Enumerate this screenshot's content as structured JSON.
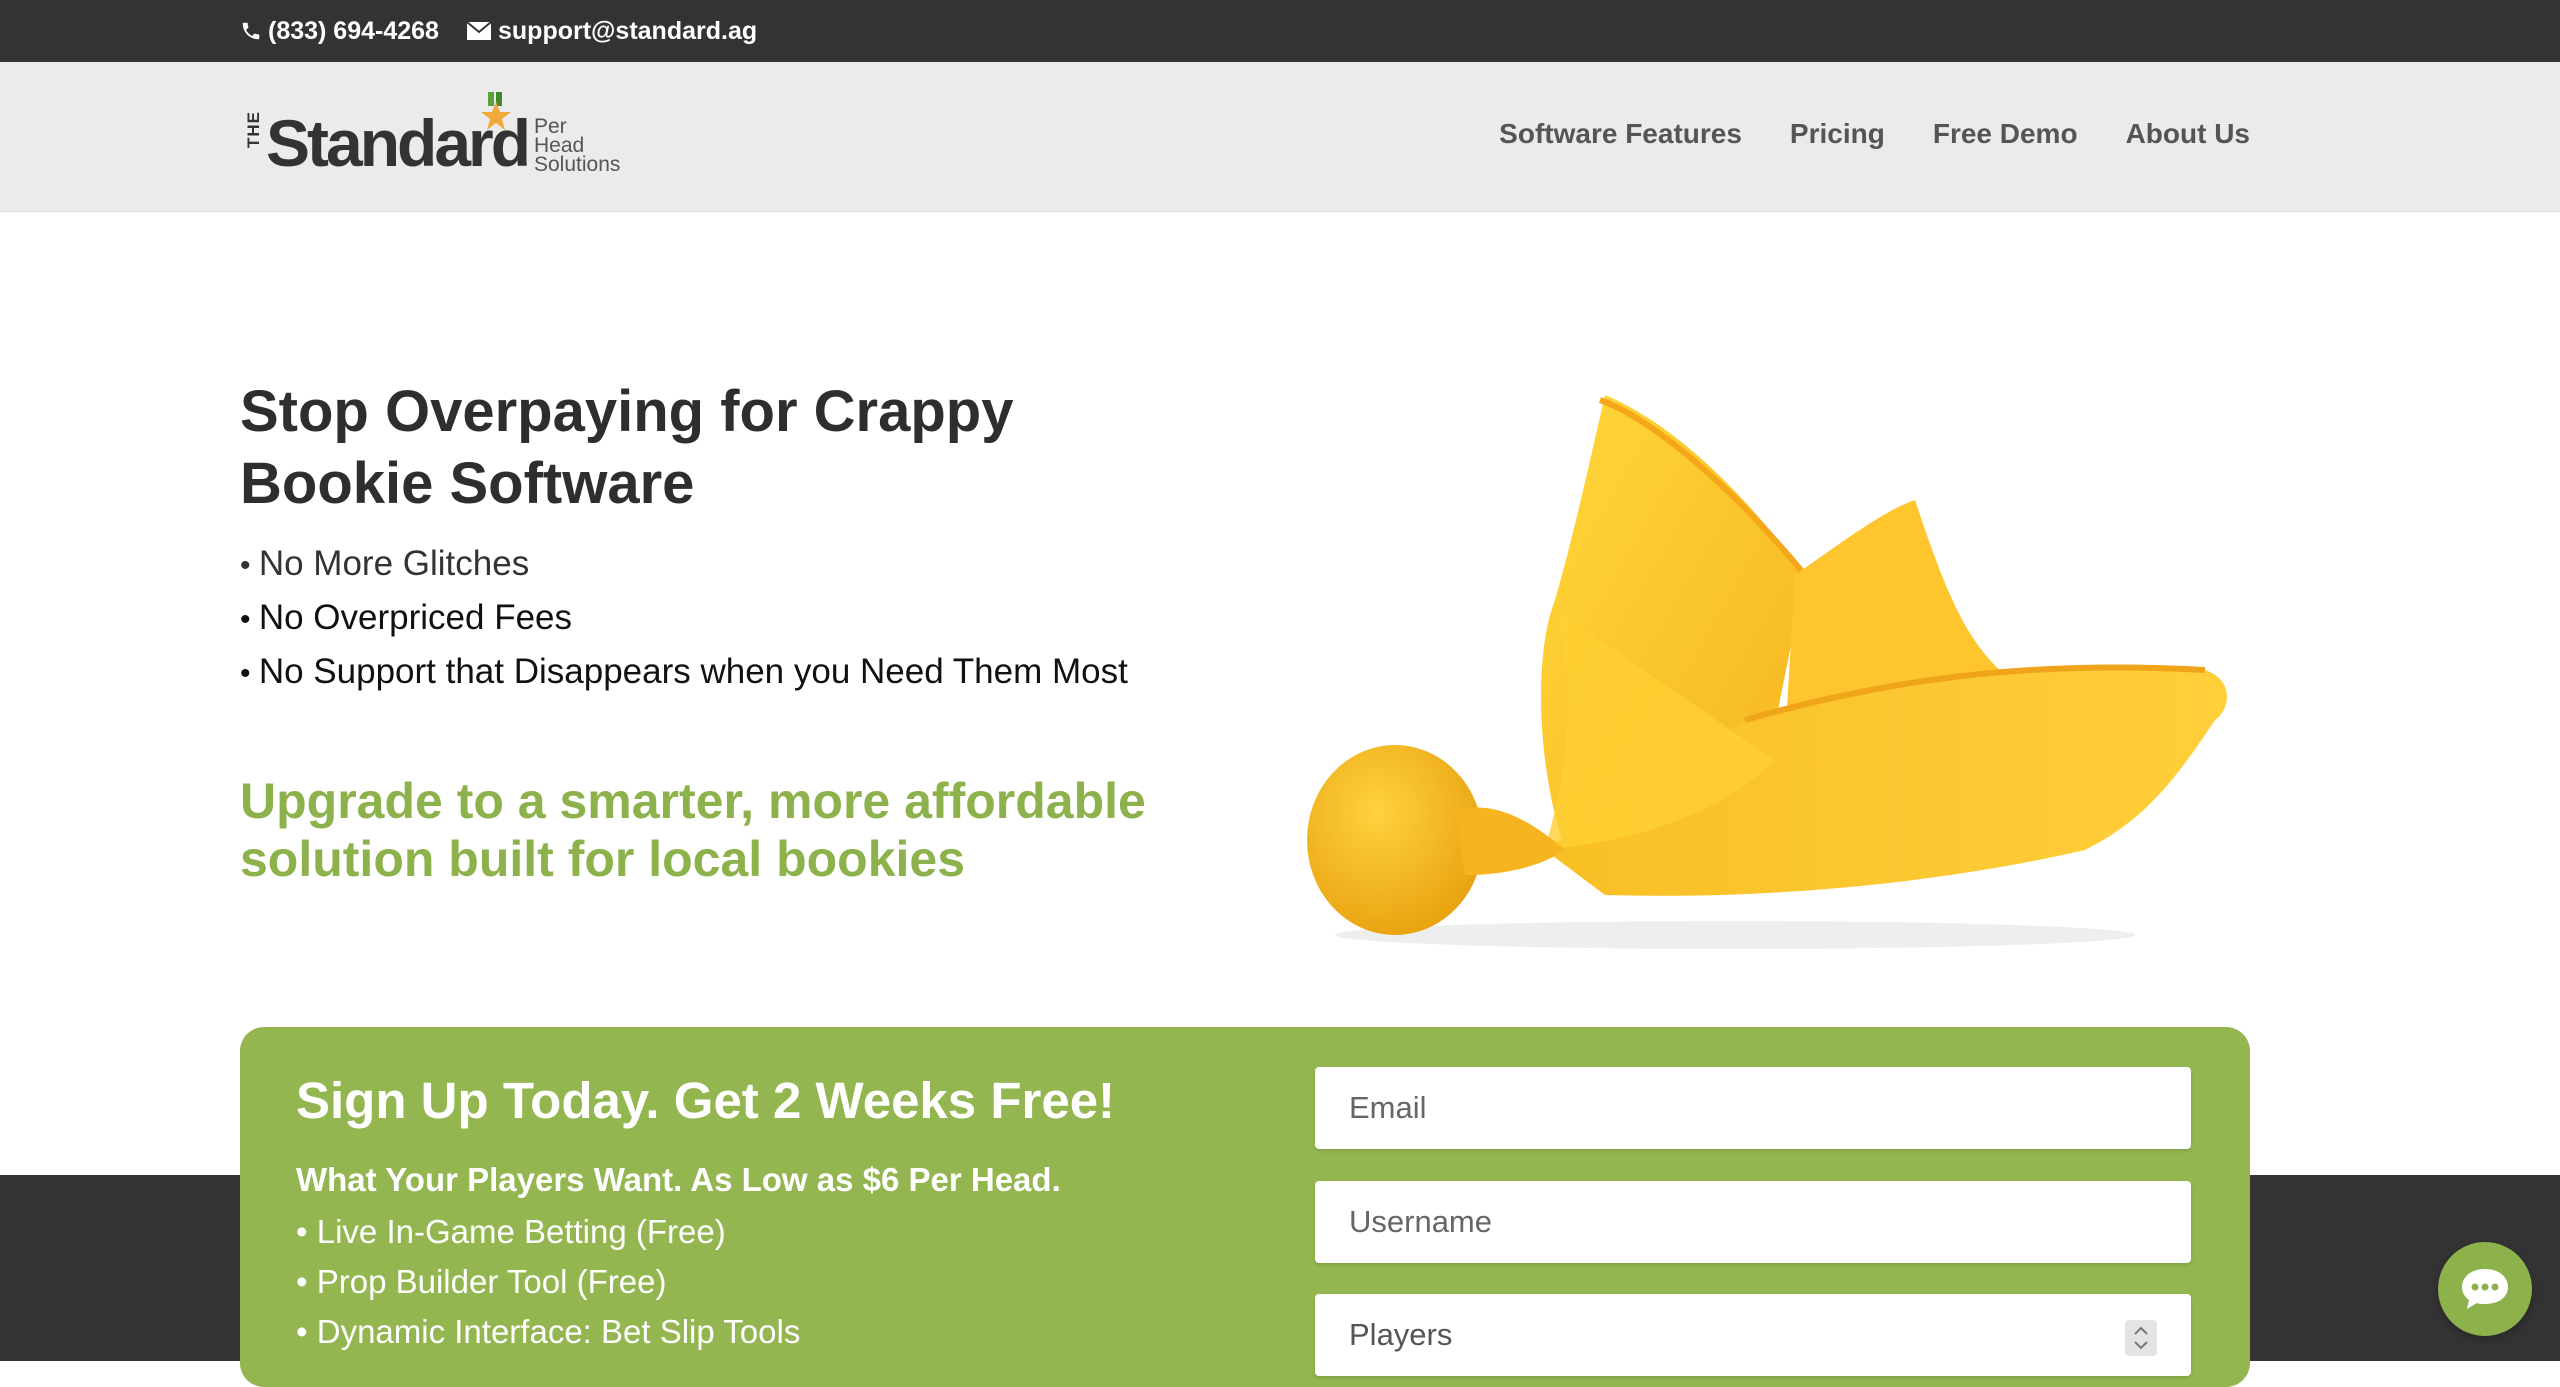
{
  "topbar": {
    "phone": "(833) 694-4268",
    "email": "support@standard.ag"
  },
  "logo": {
    "prefix": "THE",
    "word": "Standard",
    "sub1": "Per",
    "sub2": "Head",
    "sub3": "Solutions"
  },
  "nav": {
    "items": [
      {
        "label": "Software Features"
      },
      {
        "label": "Pricing"
      },
      {
        "label": "Free Demo"
      },
      {
        "label": "About Us"
      }
    ]
  },
  "hero": {
    "title": "Stop Overpaying for Crappy Bookie Software",
    "bullets": [
      "No More Glitches",
      "No Overpriced Fees",
      "No Support that Disappears when you Need Them Most"
    ],
    "tagline": "Upgrade to a smarter, more affordable solution built for local bookies"
  },
  "signup": {
    "title": "Sign Up Today. Get 2 Weeks Free!",
    "subtitle": "What Your Players Want. As Low as $6 Per Head.",
    "features": [
      "Live In-Game Betting (Free)",
      "Prop Builder Tool (Free)",
      "Dynamic Interface: Bet Slip Tools"
    ],
    "email_placeholder": "Email",
    "username_placeholder": "Username",
    "players_placeholder": "Players"
  },
  "colors": {
    "accent_green": "#93b650",
    "tagline_green": "#8db14b",
    "dark_bar": "#333333",
    "header_bg": "#ebebeb"
  },
  "icons": {
    "phone": "phone-icon",
    "mail": "mail-icon",
    "chat": "chat-icon",
    "star": "star-icon"
  }
}
